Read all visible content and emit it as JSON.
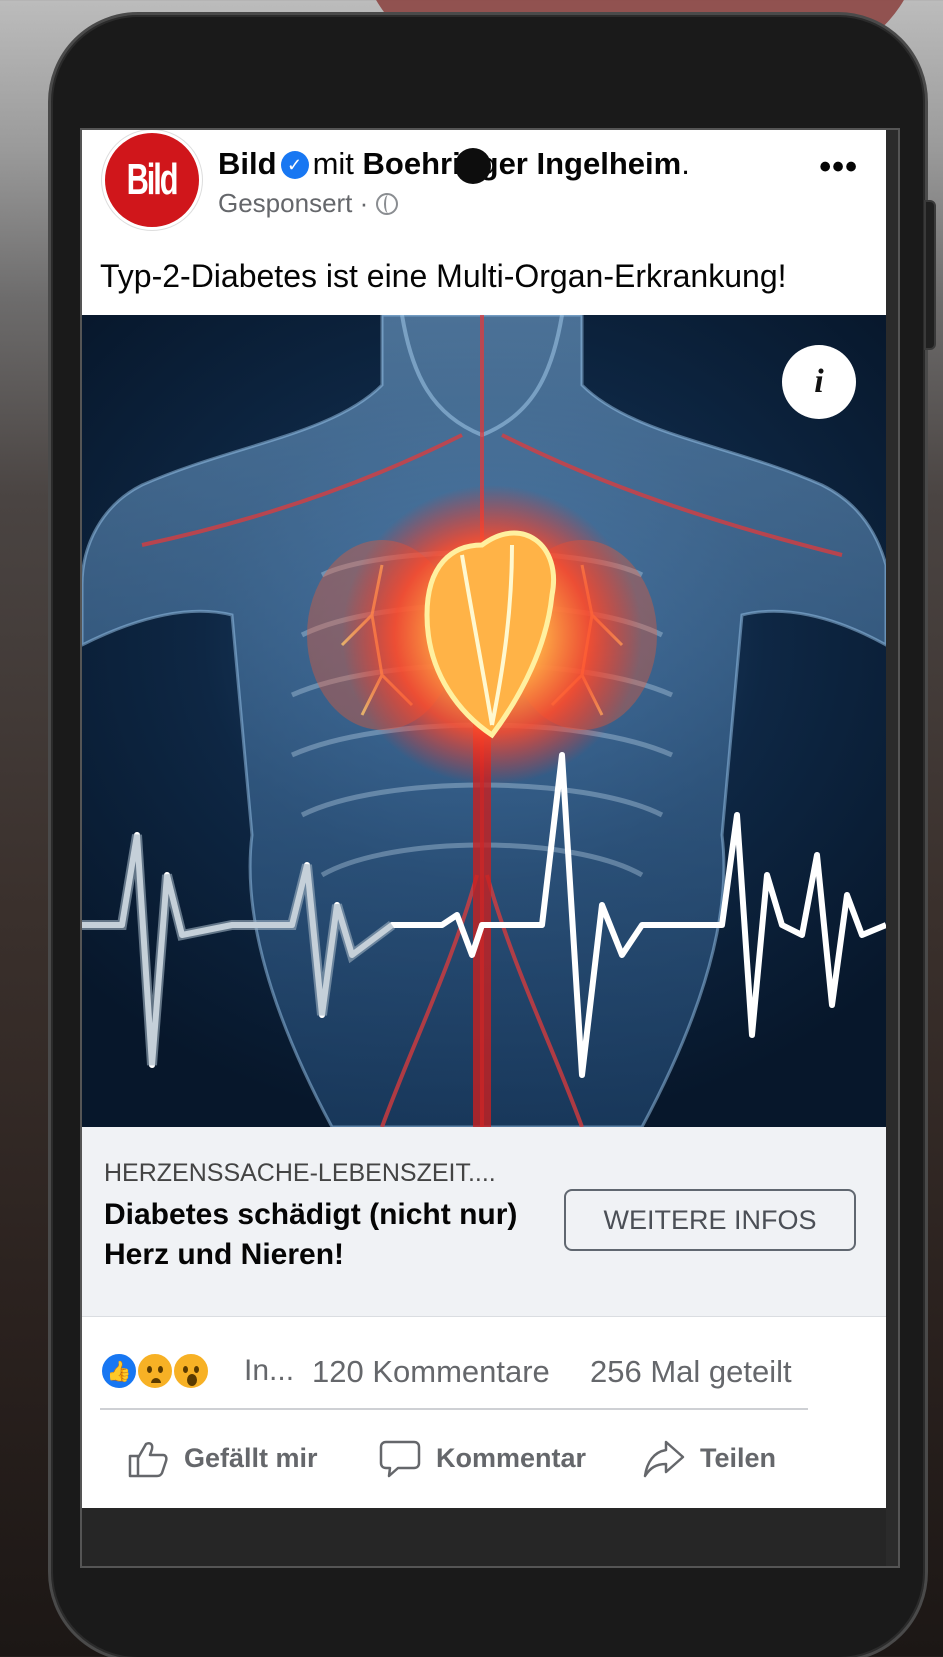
{
  "post": {
    "avatar_text": "Bild",
    "page_name": "Bild",
    "with_word": "mit",
    "partner_name": "Boehringer Ingelheim",
    "partner_suffix": ".",
    "sponsored": "Gesponsert ·",
    "text": "Typ-2-Diabetes ist eine Multi-Organ-Erkrankung!",
    "more": "•••"
  },
  "card": {
    "domain": "HERZENSSACHE-LEBENSZEIT....",
    "title": "Diabetes schädigt (nicht nur) Herz und Nieren!",
    "button": "WEITERE INFOS"
  },
  "info_glyph": "i",
  "reactions": {
    "icons": [
      "like-icon",
      "sad-icon",
      "wow-icon"
    ],
    "count": "In...",
    "comments": "120 Kommentare",
    "shares": "256 Mal geteilt"
  },
  "actions": {
    "like": "Gefällt mir",
    "comment": "Kommentar",
    "share": "Teilen"
  },
  "colors": {
    "brand_red": "#d0161b",
    "facebook_blue": "#1877f2",
    "text_gray": "#65676b"
  }
}
